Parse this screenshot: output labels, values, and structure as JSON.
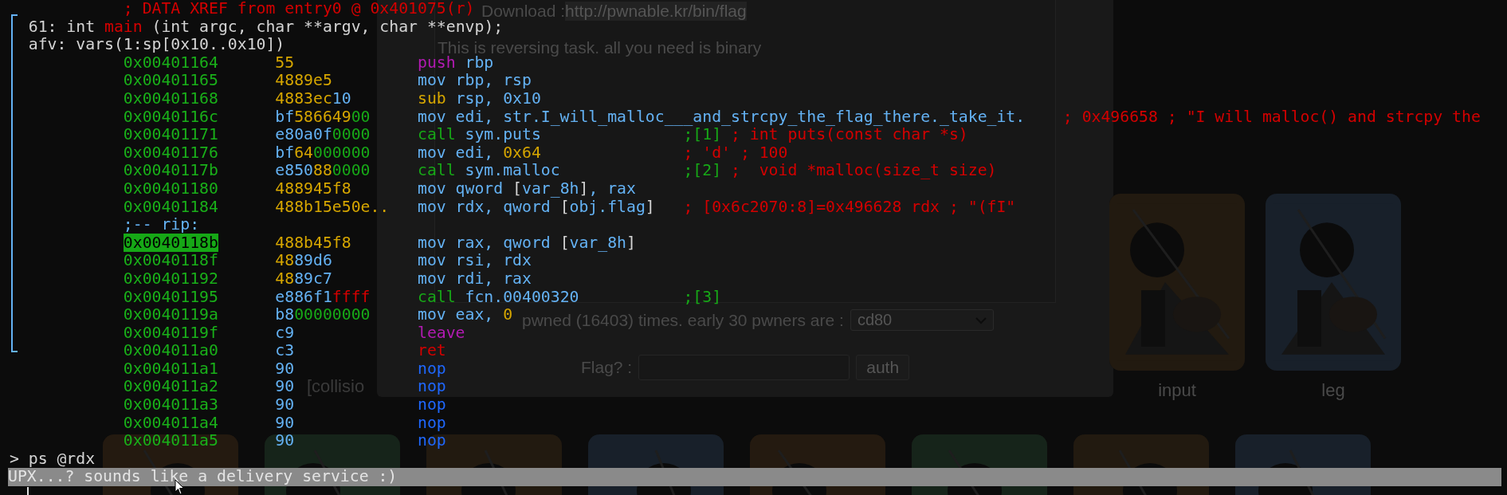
{
  "background_page": {
    "download_label": "Download : ",
    "download_link": "http://pwnable.kr/bin/flag",
    "description": "This is reversing task. all you need is binary",
    "pwned_text": "pwned (16403) times. early 30 pwners are :",
    "pwners_select": {
      "value": "cd80"
    },
    "flag_label": "Flag? :",
    "auth_button": "auth",
    "challenge_cards": [
      {
        "label": "input"
      },
      {
        "label": "leg"
      }
    ],
    "partial_label": "[collisio"
  },
  "terminal": {
    "xref": "; DATA XREF from entry0 @ 0x401075(r)",
    "signature": [
      {
        "text": "61: int ",
        "kind": "white"
      },
      {
        "text": "main",
        "kind": "red"
      },
      {
        "text": " (int argc, char **argv, char **envp);",
        "kind": "white"
      }
    ],
    "vars": "afv: vars(1:sp[0x10..0x10])",
    "lines": [
      {
        "kind": "op",
        "address": "0x00401164",
        "highlighted": false,
        "bytes": [
          {
            "text": "55",
            "kind": "yellow"
          }
        ],
        "instruction": [
          {
            "text": "push",
            "kind": "purple"
          },
          {
            "text": " rbp",
            "kind": "blue"
          }
        ]
      },
      {
        "kind": "op",
        "address": "0x00401165",
        "highlighted": false,
        "bytes": [
          {
            "text": "4889e5",
            "kind": "yellow"
          }
        ],
        "instruction": [
          {
            "text": "mov rbp, rsp",
            "kind": "blue"
          }
        ]
      },
      {
        "kind": "op",
        "address": "0x00401168",
        "highlighted": false,
        "bytes": [
          {
            "text": "4883ec",
            "kind": "yellow"
          },
          {
            "text": "10",
            "kind": "blue"
          }
        ],
        "instruction": [
          {
            "text": "sub",
            "kind": "yellow"
          },
          {
            "text": " rsp, 0x10",
            "kind": "blue"
          }
        ]
      },
      {
        "kind": "op",
        "address": "0x0040116c",
        "highlighted": false,
        "bytes": [
          {
            "text": "bf",
            "kind": "blue"
          },
          {
            "text": "586649",
            "kind": "yellow"
          },
          {
            "text": "00",
            "kind": "green"
          }
        ],
        "instruction": [
          {
            "text": "mov edi, str.I_will_malloc___and_strcpy_the_flag_there._take_it.",
            "kind": "blue"
          }
        ],
        "comment": [
          {
            "text": "; 0x496658 ; \"I will malloc() and strcpy the",
            "kind": "red"
          }
        ]
      },
      {
        "kind": "op",
        "address": "0x00401171",
        "highlighted": false,
        "bytes": [
          {
            "text": "e80a0f",
            "kind": "blue"
          },
          {
            "text": "0000",
            "kind": "green"
          }
        ],
        "instruction": [
          {
            "text": "call",
            "kind": "green"
          },
          {
            "text": " sym.puts",
            "kind": "blue"
          }
        ],
        "comment": [
          {
            "text": ";[1]",
            "kind": "green"
          },
          {
            "text": " ; int puts(const char *s)",
            "kind": "red"
          }
        ]
      },
      {
        "kind": "op",
        "address": "0x00401176",
        "highlighted": false,
        "bytes": [
          {
            "text": "bf",
            "kind": "blue"
          },
          {
            "text": "64",
            "kind": "yellow"
          },
          {
            "text": "000000",
            "kind": "green"
          }
        ],
        "instruction": [
          {
            "text": "mov edi, ",
            "kind": "blue"
          },
          {
            "text": "0x64",
            "kind": "yellow"
          }
        ],
        "comment": [
          {
            "text": "; 'd' ; 100",
            "kind": "red"
          }
        ]
      },
      {
        "kind": "op",
        "address": "0x0040117b",
        "highlighted": false,
        "bytes": [
          {
            "text": "e850",
            "kind": "blue"
          },
          {
            "text": "88",
            "kind": "yellow"
          },
          {
            "text": "0000",
            "kind": "green"
          }
        ],
        "instruction": [
          {
            "text": "call",
            "kind": "green"
          },
          {
            "text": " sym.malloc",
            "kind": "blue"
          }
        ],
        "comment": [
          {
            "text": ";[2]",
            "kind": "green"
          },
          {
            "text": " ;  void *malloc(size_t size)",
            "kind": "red"
          }
        ]
      },
      {
        "kind": "op",
        "address": "0x00401180",
        "highlighted": false,
        "bytes": [
          {
            "text": "488945f8",
            "kind": "yellow"
          }
        ],
        "instruction": [
          {
            "text": "mov qword ",
            "kind": "blue"
          },
          {
            "text": "[",
            "kind": "white"
          },
          {
            "text": "var_8h",
            "kind": "blue"
          },
          {
            "text": "]",
            "kind": "white"
          },
          {
            "text": ", rax",
            "kind": "blue"
          }
        ]
      },
      {
        "kind": "op",
        "address": "0x00401184",
        "highlighted": false,
        "bytes": [
          {
            "text": "488b15e50e..",
            "kind": "yellow"
          }
        ],
        "instruction": [
          {
            "text": "mov rdx, qword ",
            "kind": "blue"
          },
          {
            "text": "[",
            "kind": "white"
          },
          {
            "text": "obj.flag",
            "kind": "blue"
          },
          {
            "text": "]",
            "kind": "white"
          }
        ],
        "comment": [
          {
            "text": "; [0x6c2070:8]=0x496628 rdx ; \"(fI\"",
            "kind": "red"
          }
        ]
      },
      {
        "kind": "label",
        "text": ";-- rip:"
      },
      {
        "kind": "op",
        "address": "0x0040118b",
        "highlighted": true,
        "bytes": [
          {
            "text": "488b45f8",
            "kind": "yellow"
          }
        ],
        "instruction": [
          {
            "text": "mov rax, qword ",
            "kind": "blue"
          },
          {
            "text": "[",
            "kind": "white"
          },
          {
            "text": "var_8h",
            "kind": "blue"
          },
          {
            "text": "]",
            "kind": "white"
          }
        ]
      },
      {
        "kind": "op",
        "address": "0x0040118f",
        "highlighted": false,
        "bytes": [
          {
            "text": "48",
            "kind": "yellow"
          },
          {
            "text": "89d6",
            "kind": "blue"
          }
        ],
        "instruction": [
          {
            "text": "mov rsi, rdx",
            "kind": "blue"
          }
        ]
      },
      {
        "kind": "op",
        "address": "0x00401192",
        "highlighted": false,
        "bytes": [
          {
            "text": "48",
            "kind": "yellow"
          },
          {
            "text": "89c7",
            "kind": "blue"
          }
        ],
        "instruction": [
          {
            "text": "mov rdi, rax",
            "kind": "blue"
          }
        ]
      },
      {
        "kind": "op",
        "address": "0x00401195",
        "highlighted": false,
        "bytes": [
          {
            "text": "e886f1",
            "kind": "blue"
          },
          {
            "text": "ffff",
            "kind": "red"
          }
        ],
        "instruction": [
          {
            "text": "call",
            "kind": "green"
          },
          {
            "text": " fcn.00400320",
            "kind": "blue"
          }
        ],
        "comment": [
          {
            "text": ";[3]",
            "kind": "green"
          }
        ]
      },
      {
        "kind": "op",
        "address": "0x0040119a",
        "highlighted": false,
        "bytes": [
          {
            "text": "b8",
            "kind": "blue"
          },
          {
            "text": "00000000",
            "kind": "green"
          }
        ],
        "instruction": [
          {
            "text": "mov eax, ",
            "kind": "blue"
          },
          {
            "text": "0",
            "kind": "yellow"
          }
        ]
      },
      {
        "kind": "op",
        "address": "0x0040119f",
        "highlighted": false,
        "bytes": [
          {
            "text": "c9",
            "kind": "blue"
          }
        ],
        "instruction": [
          {
            "text": "leave",
            "kind": "purple"
          }
        ]
      },
      {
        "kind": "op",
        "address": "0x004011a0",
        "highlighted": false,
        "bytes": [
          {
            "text": "c3",
            "kind": "blue"
          }
        ],
        "instruction": [
          {
            "text": "ret",
            "kind": "red"
          }
        ]
      },
      {
        "kind": "op",
        "address": "0x004011a1",
        "highlighted": false,
        "bytes": [
          {
            "text": "90",
            "kind": "blue"
          }
        ],
        "instruction": [
          {
            "text": "nop",
            "kind": "nop"
          }
        ]
      },
      {
        "kind": "op",
        "address": "0x004011a2",
        "highlighted": false,
        "bytes": [
          {
            "text": "90",
            "kind": "blue"
          }
        ],
        "instruction": [
          {
            "text": "nop",
            "kind": "nop"
          }
        ]
      },
      {
        "kind": "op",
        "address": "0x004011a3",
        "highlighted": false,
        "bytes": [
          {
            "text": "90",
            "kind": "blue"
          }
        ],
        "instruction": [
          {
            "text": "nop",
            "kind": "nop"
          }
        ]
      },
      {
        "kind": "op",
        "address": "0x004011a4",
        "highlighted": false,
        "bytes": [
          {
            "text": "90",
            "kind": "blue"
          }
        ],
        "instruction": [
          {
            "text": "nop",
            "kind": "nop"
          }
        ]
      },
      {
        "kind": "op",
        "address": "0x004011a5",
        "highlighted": false,
        "bytes": [
          {
            "text": "90",
            "kind": "blue"
          }
        ],
        "instruction": [
          {
            "text": "nop",
            "kind": "nop"
          }
        ]
      }
    ],
    "prompt": "> ps @rdx",
    "output": "UPX...? sounds like a delivery service :)"
  }
}
